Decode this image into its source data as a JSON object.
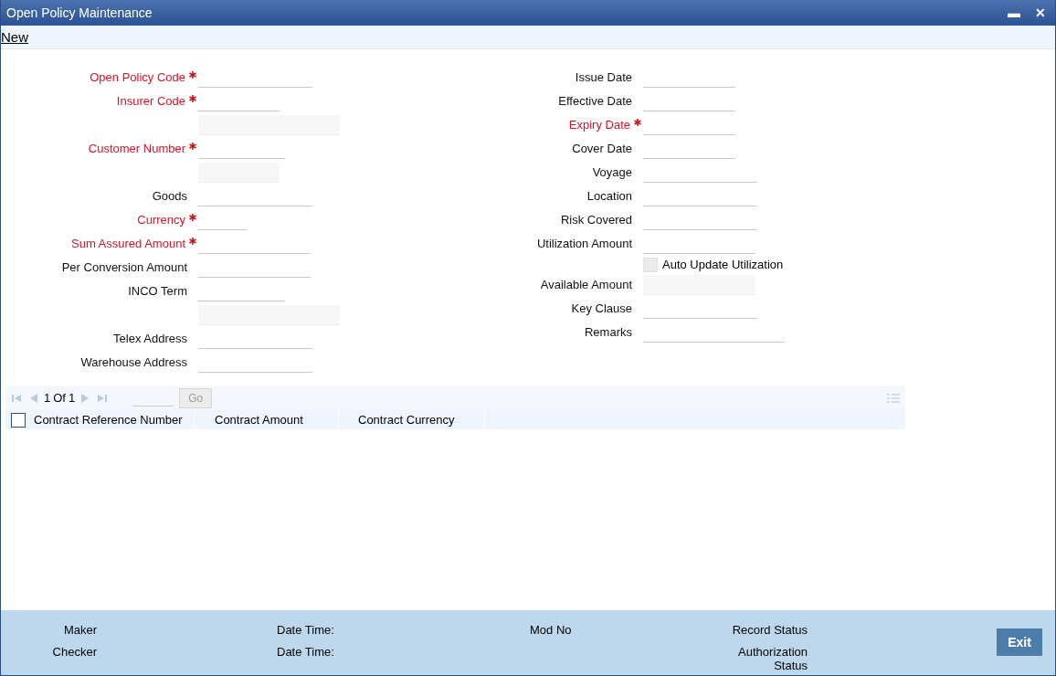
{
  "window": {
    "title": "Open Policy Maintenance",
    "controls": [
      "▬",
      "✕"
    ]
  },
  "toolbar": {
    "link": "New"
  },
  "left_fields": [
    {
      "kind": "input",
      "label": "Open Policy Code",
      "required": true
    },
    {
      "kind": "input",
      "label": "Insurer Code",
      "required": true
    },
    {
      "kind": "display"
    },
    {
      "kind": "input",
      "label": "Customer Number",
      "required": true
    },
    {
      "kind": "display"
    },
    {
      "kind": "input",
      "label": "Goods",
      "required": false
    },
    {
      "kind": "input",
      "label": "Currency",
      "required": true
    },
    {
      "kind": "input",
      "label": "Sum Assured Amount",
      "required": true
    },
    {
      "kind": "input",
      "label": "Per Conversion Amount",
      "required": false
    },
    {
      "kind": "input",
      "label": "INCO Term",
      "required": false
    },
    {
      "kind": "display"
    },
    {
      "kind": "input",
      "label": "Telex Address",
      "required": false
    },
    {
      "kind": "input",
      "label": "Warehouse Address",
      "required": false
    }
  ],
  "right_fields": [
    {
      "kind": "input",
      "label": "Issue Date",
      "required": false
    },
    {
      "kind": "input",
      "label": "Effective Date",
      "required": false
    },
    {
      "kind": "input",
      "label": "Expiry Date",
      "required": true
    },
    {
      "kind": "input",
      "label": "Cover Date",
      "required": false
    },
    {
      "kind": "input",
      "label": "Voyage",
      "required": false
    },
    {
      "kind": "input",
      "label": "Location",
      "required": false
    },
    {
      "kind": "input",
      "label": "Risk Covered",
      "required": false
    },
    {
      "kind": "input",
      "label": "Utilization Amount",
      "required": false
    },
    {
      "kind": "checkbox",
      "label": "Auto Update Utilization",
      "checked": false
    },
    {
      "kind": "display",
      "label": "Available Amount"
    },
    {
      "kind": "input",
      "label": "Key Clause",
      "required": false
    },
    {
      "kind": "input",
      "label": "Remarks",
      "required": false
    }
  ],
  "grid": {
    "page": "1",
    "of_label": "Of",
    "total": "1",
    "go": "Go",
    "columns": [
      "Contract Reference Number",
      "Contract Amount",
      "Contract Currency"
    ],
    "select_all": false
  },
  "footer": {
    "row_1": [
      "Maker",
      "Date Time:",
      "Mod No",
      "Record Status"
    ],
    "row_2": [
      "Checker",
      "Date Time:",
      "Authorization Status"
    ],
    "exit": "Exit"
  }
}
